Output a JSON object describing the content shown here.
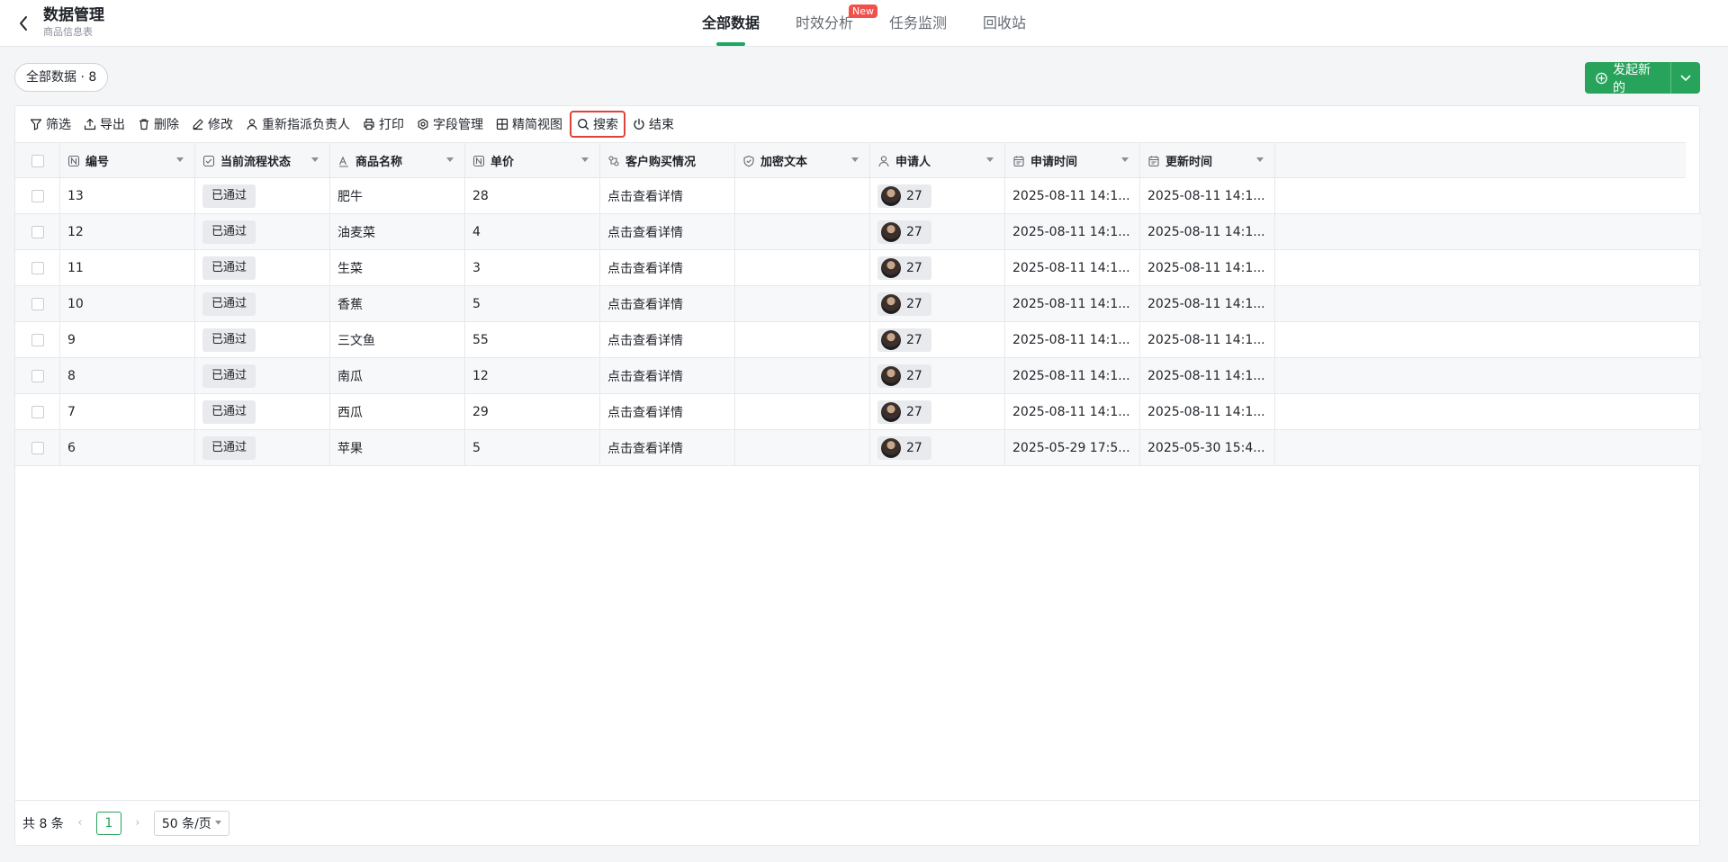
{
  "header": {
    "title": "数据管理",
    "subtitle": "商品信息表",
    "tabs": [
      {
        "label": "全部数据"
      },
      {
        "label": "时效分析"
      },
      {
        "label": "任务监测"
      },
      {
        "label": "回收站"
      }
    ],
    "new_badge": "New"
  },
  "summary": {
    "pill": "全部数据 · 8",
    "launch_label": "发起新的"
  },
  "toolbar": {
    "filter": "筛选",
    "export": "导出",
    "delete": "删除",
    "edit": "修改",
    "reassign": "重新指派负责人",
    "print": "打印",
    "fields": "字段管理",
    "compact": "精简视图",
    "search": "搜索",
    "end": "结束"
  },
  "table": {
    "columns": {
      "id": "编号",
      "status": "当前流程状态",
      "name": "商品名称",
      "price": "单价",
      "purchase": "客户购买情况",
      "encrypted": "加密文本",
      "applicant": "申请人",
      "apply_time": "申请时间",
      "update_time": "更新时间"
    },
    "rows": [
      {
        "id": "13",
        "status": "已通过",
        "name": "肥牛",
        "price": "28",
        "purchase": "点击查看详情",
        "encrypted": "",
        "applicant": "27",
        "apply_time": "2025-08-11 14:1...",
        "update_time": "2025-08-11 14:1..."
      },
      {
        "id": "12",
        "status": "已通过",
        "name": "油麦菜",
        "price": "4",
        "purchase": "点击查看详情",
        "encrypted": "",
        "applicant": "27",
        "apply_time": "2025-08-11 14:1...",
        "update_time": "2025-08-11 14:1..."
      },
      {
        "id": "11",
        "status": "已通过",
        "name": "生菜",
        "price": "3",
        "purchase": "点击查看详情",
        "encrypted": "",
        "applicant": "27",
        "apply_time": "2025-08-11 14:1...",
        "update_time": "2025-08-11 14:1..."
      },
      {
        "id": "10",
        "status": "已通过",
        "name": "香蕉",
        "price": "5",
        "purchase": "点击查看详情",
        "encrypted": "",
        "applicant": "27",
        "apply_time": "2025-08-11 14:1...",
        "update_time": "2025-08-11 14:1..."
      },
      {
        "id": "9",
        "status": "已通过",
        "name": "三文鱼",
        "price": "55",
        "purchase": "点击查看详情",
        "encrypted": "",
        "applicant": "27",
        "apply_time": "2025-08-11 14:1...",
        "update_time": "2025-08-11 14:1..."
      },
      {
        "id": "8",
        "status": "已通过",
        "name": "南瓜",
        "price": "12",
        "purchase": "点击查看详情",
        "encrypted": "",
        "applicant": "27",
        "apply_time": "2025-08-11 14:1...",
        "update_time": "2025-08-11 14:1..."
      },
      {
        "id": "7",
        "status": "已通过",
        "name": "西瓜",
        "price": "29",
        "purchase": "点击查看详情",
        "encrypted": "",
        "applicant": "27",
        "apply_time": "2025-08-11 14:1...",
        "update_time": "2025-08-11 14:1..."
      },
      {
        "id": "6",
        "status": "已通过",
        "name": "苹果",
        "price": "5",
        "purchase": "点击查看详情",
        "encrypted": "",
        "applicant": "27",
        "apply_time": "2025-05-29 17:5...",
        "update_time": "2025-05-30 15:4..."
      }
    ]
  },
  "pagination": {
    "total": "共 8 条",
    "current_page": "1",
    "page_size": "50 条/页"
  },
  "colors": {
    "accent": "#27a35b",
    "highlight": "#e0423b",
    "badge": "#f2504b"
  }
}
